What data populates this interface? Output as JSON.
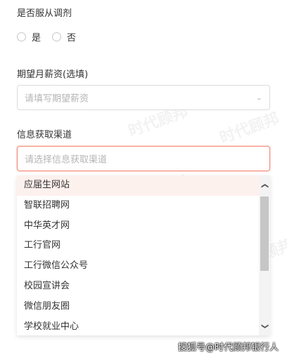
{
  "obey_adjustment": {
    "label": "是否服从调剂",
    "options": [
      "是",
      "否"
    ]
  },
  "expected_salary": {
    "label": "期望月薪资(选填)",
    "placeholder": "请填写期望薪资"
  },
  "channel": {
    "label": "信息获取渠道",
    "placeholder": "请选择信息获取渠道",
    "options": [
      "应届生网站",
      "智联招聘网",
      "中华英才网",
      "工行官网",
      "工行微信公众号",
      "校园宣讲会",
      "微信朋友圈",
      "学校就业中心"
    ]
  },
  "watermark": {
    "brand": "时代顾邦",
    "footer": "搜狐号@时代顾邦银行人"
  },
  "colors": {
    "focus_border": "#f28b7a",
    "active_option_bg": "#fdf1ee"
  }
}
